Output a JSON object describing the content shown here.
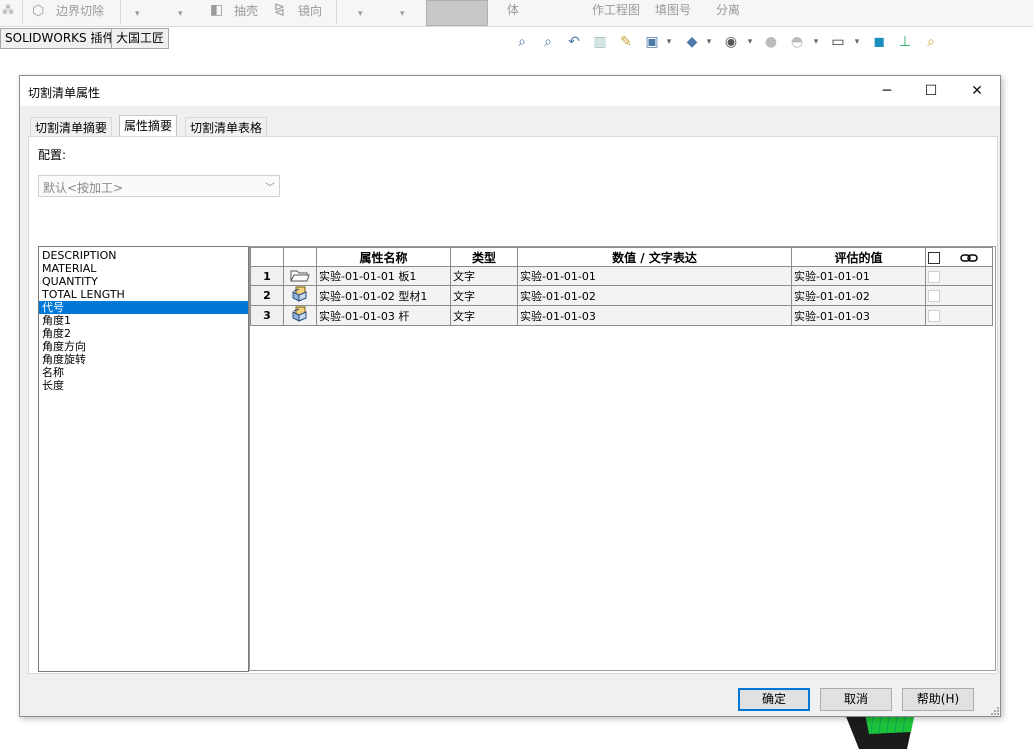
{
  "background": {
    "ribbon": {
      "boundary_cut": "边界切除",
      "shell": "抽壳",
      "mirror": "镜向",
      "partial_1": "体",
      "partial_2": "作工程图",
      "partial_3": "填图号",
      "partial_4": "分离"
    },
    "command_tabs": [
      "SOLIDWORKS 插件",
      "大国工匠"
    ]
  },
  "dialog": {
    "title": "切割清单属性",
    "tabs": [
      "切割清单摘要",
      "属性摘要",
      "切割清单表格"
    ],
    "active_tab": 1,
    "config_label": "配置:",
    "config_value": "默认<按加工>",
    "property_list": [
      "DESCRIPTION",
      "MATERIAL",
      "QUANTITY",
      "TOTAL LENGTH",
      "代号",
      "角度1",
      "角度2",
      "角度方向",
      "角度旋转",
      "名称",
      "长度"
    ],
    "selected_property": 4,
    "table": {
      "headers": [
        "属性名称",
        "类型",
        "数值 / 文字表达",
        "评估的值"
      ],
      "rows": [
        {
          "num": "1",
          "icon": "folder-icon",
          "name": "实验-01-01-01 板1",
          "type": "文字",
          "value": "实验-01-01-01",
          "evaluated": "实验-01-01-01"
        },
        {
          "num": "2",
          "icon": "weldment-icon",
          "name": "实验-01-01-02 型材1",
          "type": "文字",
          "value": "实验-01-01-02",
          "evaluated": "实验-01-01-02"
        },
        {
          "num": "3",
          "icon": "weldment-icon",
          "name": "实验-01-01-03 杆",
          "type": "文字",
          "value": "实验-01-01-03",
          "evaluated": "实验-01-01-03"
        }
      ]
    },
    "buttons": {
      "ok": "确定",
      "cancel": "取消",
      "help": "帮助(H)"
    },
    "accent": "#0078d7"
  }
}
